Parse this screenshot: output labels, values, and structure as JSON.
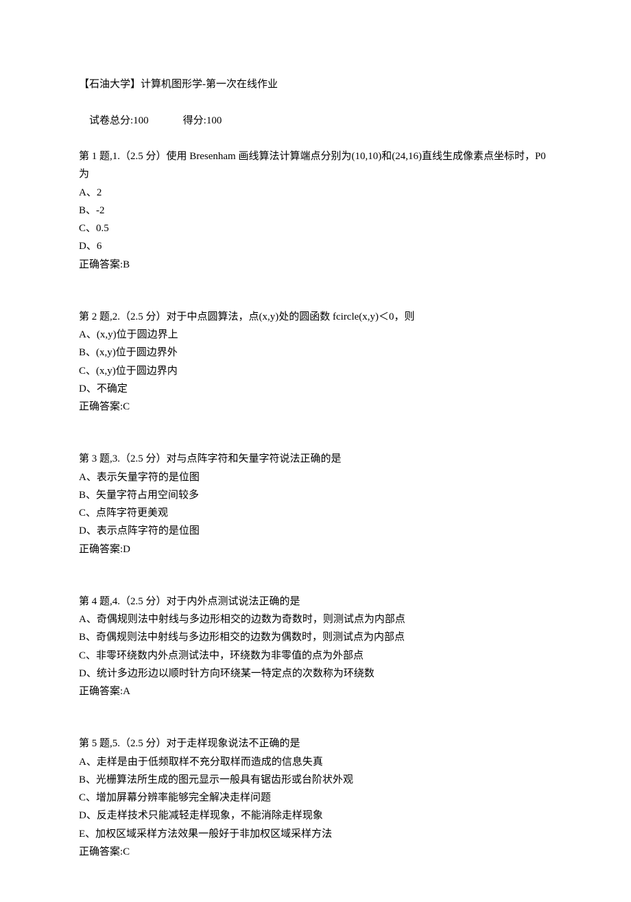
{
  "header": {
    "title": "【石油大学】计算机图形学-第一次在线作业",
    "total_label": "试卷总分:",
    "total": "100",
    "score_label": "得分:",
    "score": "100"
  },
  "questions": [
    {
      "prompt": "第 1 题,1.（2.5 分）使用 Bresenham 画线算法计算端点分别为(10,10)和(24,16)直线生成像素点坐标时，P0 为",
      "options": [
        "A、2",
        "B、-2",
        "C、0.5",
        "D、6"
      ],
      "answer_label": "正确答案:",
      "answer": "B"
    },
    {
      "prompt": "第 2 题,2.（2.5 分）对于中点圆算法，点(x,y)处的圆函数 fcircle(x,y)＜0，则",
      "options": [
        "A、(x,y)位于圆边界上",
        "B、(x,y)位于圆边界外",
        "C、(x,y)位于圆边界内",
        "D、不确定"
      ],
      "answer_label": "正确答案:",
      "answer": "C"
    },
    {
      "prompt": "第 3 题,3.（2.5 分）对与点阵字符和矢量字符说法正确的是",
      "options": [
        "A、表示矢量字符的是位图",
        "B、矢量字符占用空间较多",
        "C、点阵字符更美观",
        "D、表示点阵字符的是位图"
      ],
      "answer_label": "正确答案:",
      "answer": "D"
    },
    {
      "prompt": "第 4 题,4.（2.5 分）对于内外点测试说法正确的是",
      "options": [
        "A、奇偶规则法中射线与多边形相交的边数为奇数时，则测试点为内部点",
        "B、奇偶规则法中射线与多边形相交的边数为偶数时，则测试点为内部点",
        "C、非零环绕数内外点测试法中，环绕数为非零值的点为外部点",
        "D、统计多边形边以顺时针方向环绕某一特定点的次数称为环绕数"
      ],
      "answer_label": "正确答案:",
      "answer": "A"
    },
    {
      "prompt": "第 5 题,5.（2.5 分）对于走样现象说法不正确的是",
      "options": [
        "A、走样是由于低频取样不充分取样而造成的信息失真",
        "B、光栅算法所生成的图元显示一般具有锯齿形或台阶状外观",
        "C、增加屏幕分辨率能够完全解决走样问题",
        "D、反走样技术只能减轻走样现象，不能消除走样现象",
        "E、加权区域采样方法效果一般好于非加权区域采样方法"
      ],
      "answer_label": "正确答案:",
      "answer": "C"
    }
  ]
}
